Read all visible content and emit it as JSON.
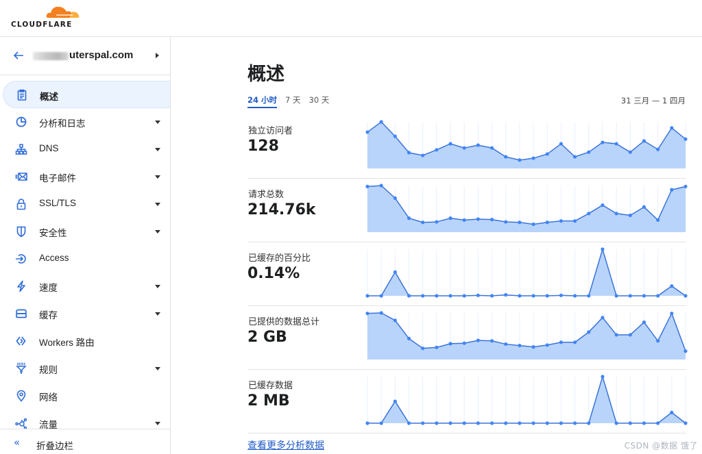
{
  "header": {
    "brand": "CLOUDFLARE",
    "brand_colors": {
      "cloud_primary": "#f38020",
      "cloud_secondary": "#faae40"
    }
  },
  "sidebar": {
    "domain_suffix": "uterspal.com",
    "items": [
      {
        "label": "概述",
        "icon": "clipboard-icon",
        "active": true,
        "has_dropdown": false
      },
      {
        "label": "分析和日志",
        "icon": "pie-chart-icon",
        "active": false,
        "has_dropdown": true
      },
      {
        "label": "DNS",
        "icon": "network-tree-icon",
        "active": false,
        "has_dropdown": true
      },
      {
        "label": "电子邮件",
        "icon": "email-icon",
        "active": false,
        "has_dropdown": true
      },
      {
        "label": "SSL/TLS",
        "icon": "lock-icon",
        "active": false,
        "has_dropdown": true
      },
      {
        "label": "安全性",
        "icon": "shield-icon",
        "active": false,
        "has_dropdown": true
      },
      {
        "label": "Access",
        "icon": "access-icon",
        "active": false,
        "has_dropdown": false
      },
      {
        "label": "速度",
        "icon": "lightning-icon",
        "active": false,
        "has_dropdown": true
      },
      {
        "label": "缓存",
        "icon": "storage-icon",
        "active": false,
        "has_dropdown": true
      },
      {
        "label": "Workers 路由",
        "icon": "workers-icon",
        "active": false,
        "has_dropdown": false
      },
      {
        "label": "规则",
        "icon": "filter-icon",
        "active": false,
        "has_dropdown": true
      },
      {
        "label": "网络",
        "icon": "location-pin-icon",
        "active": false,
        "has_dropdown": false
      },
      {
        "label": "流量",
        "icon": "traffic-icon",
        "active": false,
        "has_dropdown": true
      }
    ],
    "collapse_label": "折叠边栏"
  },
  "main": {
    "title": "概述",
    "tabs": [
      {
        "label": "24 小时",
        "active": true
      },
      {
        "label": "7 天",
        "active": false
      },
      {
        "label": "30 天",
        "active": false
      }
    ],
    "date_range": "31 三月 — 1 四月",
    "more_link": "查看更多分析数据",
    "watermark": "CSDN @数据 饿了",
    "accent_color": "#1f5bc6"
  },
  "chart_data": [
    {
      "type": "area",
      "title": "独立访问者",
      "summary_value": "128",
      "x": [
        0,
        1,
        2,
        3,
        4,
        5,
        6,
        7,
        8,
        9,
        10,
        11,
        12,
        13,
        14,
        15,
        16,
        17,
        18,
        19,
        20,
        21,
        22,
        23
      ],
      "values": [
        78,
        100,
        69,
        34,
        28,
        40,
        53,
        44,
        50,
        44,
        25,
        18,
        22,
        31,
        53,
        25,
        35,
        56,
        53,
        35,
        59,
        41,
        87,
        63
      ],
      "ylim": [
        0,
        100
      ],
      "color": "#4285f4",
      "fill": "#b9d4fb"
    },
    {
      "type": "area",
      "title": "请求总数",
      "summary_value": "214.76k",
      "x": [
        0,
        1,
        2,
        3,
        4,
        5,
        6,
        7,
        8,
        9,
        10,
        11,
        12,
        13,
        14,
        15,
        16,
        17,
        18,
        19,
        20,
        21,
        22,
        23
      ],
      "values": [
        98,
        100,
        73,
        30,
        21,
        22,
        30,
        26,
        28,
        27,
        22,
        21,
        17,
        21,
        24,
        24,
        40,
        58,
        40,
        36,
        54,
        26,
        91,
        98
      ],
      "ylim": [
        0,
        100
      ],
      "color": "#4285f4",
      "fill": "#b9d4fb"
    },
    {
      "type": "area",
      "title": "已缓存的百分比",
      "summary_value": "0.14%",
      "x": [
        0,
        1,
        2,
        3,
        4,
        5,
        6,
        7,
        8,
        9,
        10,
        11,
        12,
        13,
        14,
        15,
        16,
        17,
        18,
        19,
        20,
        21,
        22,
        23
      ],
      "values": [
        0,
        0,
        51,
        0,
        0,
        0,
        0,
        0,
        1,
        0,
        2,
        0,
        0,
        0,
        1,
        0,
        0,
        100,
        0,
        0,
        0,
        0,
        21,
        0
      ],
      "ylim": [
        0,
        100
      ],
      "color": "#4285f4",
      "fill": "#b9d4fb"
    },
    {
      "type": "area",
      "title": "已提供的数据总计",
      "summary_value": "2 GB",
      "x": [
        0,
        1,
        2,
        3,
        4,
        5,
        6,
        7,
        8,
        9,
        10,
        11,
        12,
        13,
        14,
        15,
        16,
        17,
        18,
        19,
        20,
        21,
        22,
        23
      ],
      "values": [
        99,
        100,
        84,
        45,
        24,
        26,
        34,
        35,
        41,
        40,
        33,
        30,
        27,
        31,
        37,
        37,
        59,
        90,
        53,
        53,
        80,
        40,
        99,
        18
      ],
      "ylim": [
        0,
        100
      ],
      "color": "#4285f4",
      "fill": "#b9d4fb"
    },
    {
      "type": "area",
      "title": "已缓存数据",
      "summary_value": "2 MB",
      "x": [
        0,
        1,
        2,
        3,
        4,
        5,
        6,
        7,
        8,
        9,
        10,
        11,
        12,
        13,
        14,
        15,
        16,
        17,
        18,
        19,
        20,
        21,
        22,
        23
      ],
      "values": [
        0,
        0,
        47,
        0,
        0,
        0,
        0,
        0,
        0,
        0,
        0,
        0,
        0,
        0,
        0,
        0,
        0,
        100,
        0,
        0,
        0,
        0,
        23,
        0
      ],
      "ylim": [
        0,
        100
      ],
      "color": "#4285f4",
      "fill": "#b9d4fb"
    }
  ]
}
